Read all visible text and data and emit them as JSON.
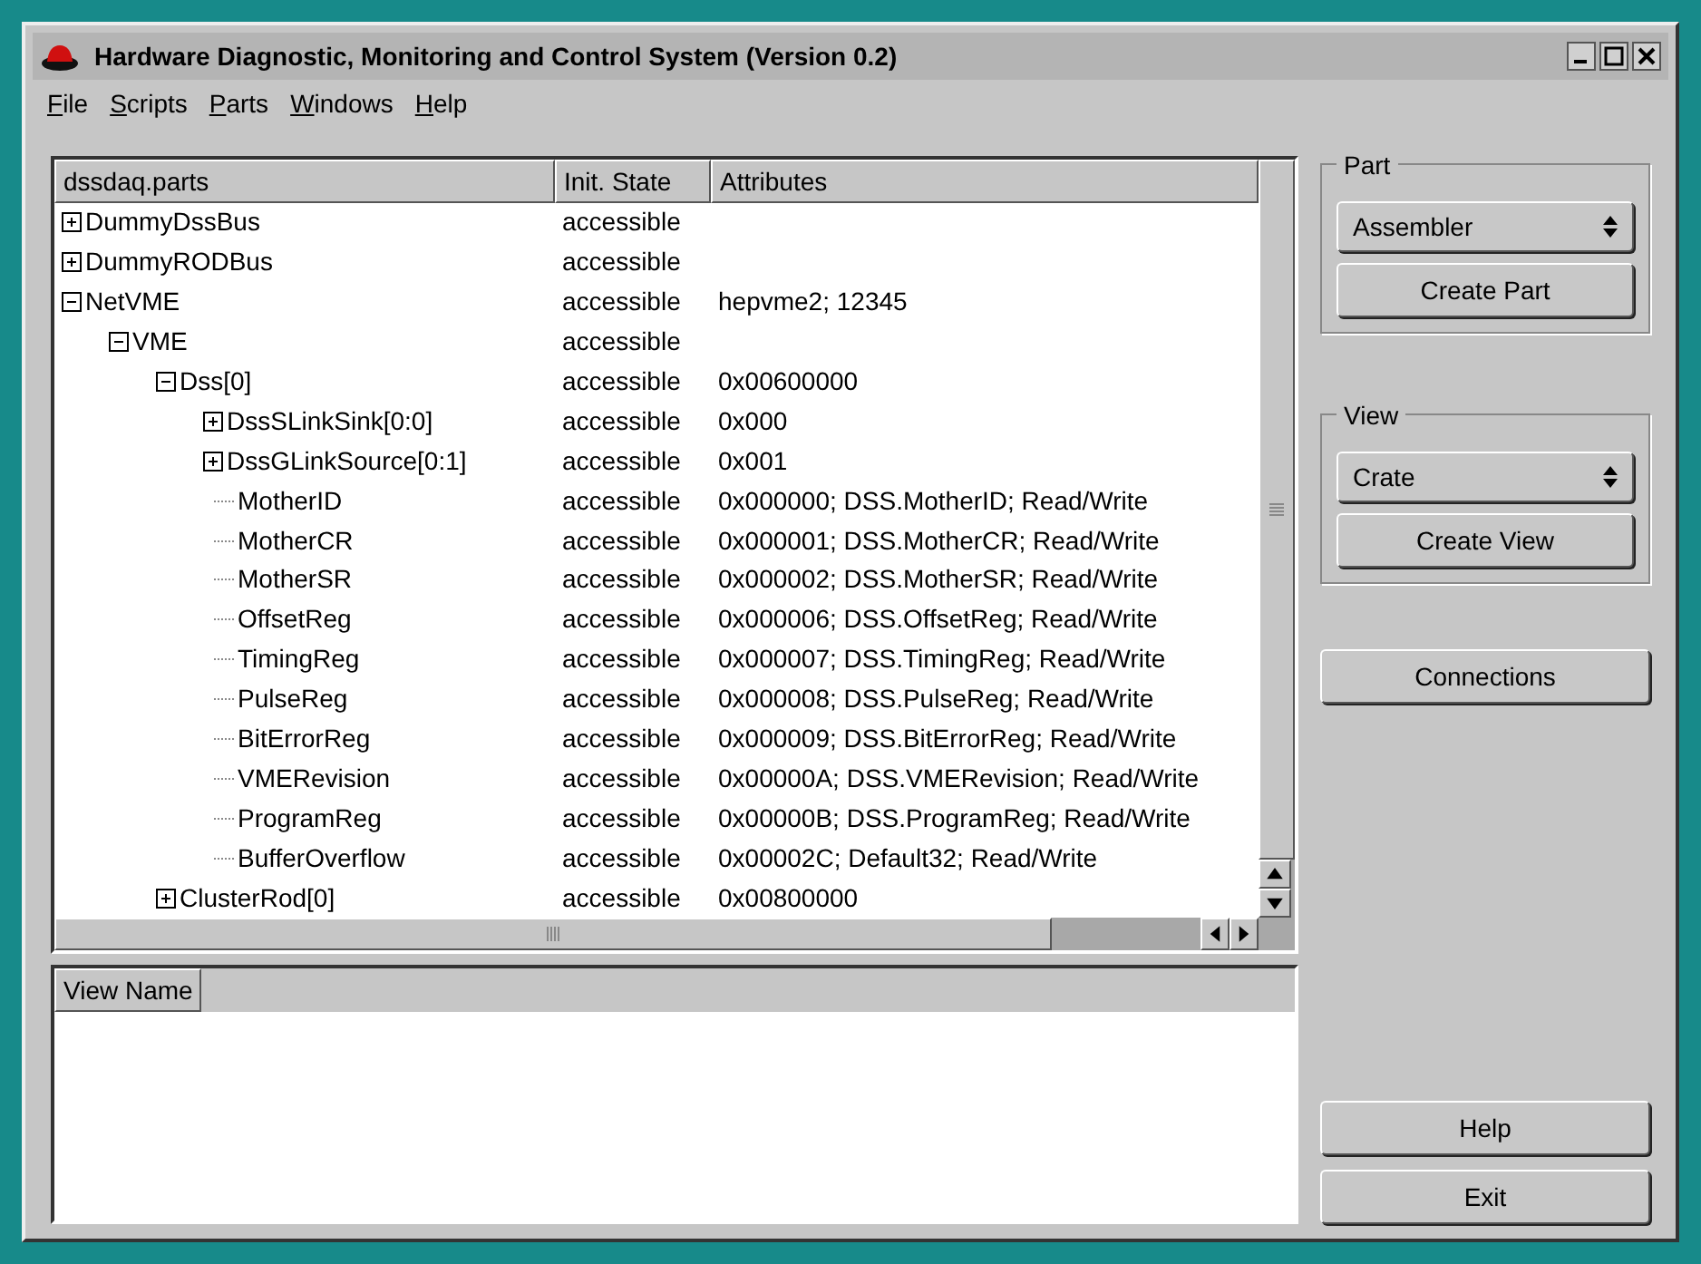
{
  "window": {
    "title": "Hardware Diagnostic, Monitoring and Control System (Version 0.2)"
  },
  "menu": [
    "File",
    "Scripts",
    "Parts",
    "Windows",
    "Help"
  ],
  "tree": {
    "columns": [
      "dssdaq.parts",
      "Init. State",
      "Attributes"
    ],
    "rows": [
      {
        "name": "DummyDssBus",
        "state": "accessible",
        "expanded": false
      },
      {
        "name": "DummyRODBus",
        "state": "accessible",
        "expanded": false
      },
      {
        "name": "NetVME",
        "state": "accessible",
        "attributes": "hepvme2; 12345",
        "expanded": true,
        "children": [
          {
            "name": "VME",
            "state": "accessible",
            "expanded": true,
            "children": [
              {
                "name": "Dss[0]",
                "state": "accessible",
                "attributes": "0x00600000",
                "expanded": true,
                "children": [
                  {
                    "name": "DssSLinkSink[0:0]",
                    "state": "accessible",
                    "attributes": "0x000",
                    "expanded": false
                  },
                  {
                    "name": "DssGLinkSource[0:1]",
                    "state": "accessible",
                    "attributes": "0x001",
                    "expanded": false
                  },
                  {
                    "name": "MotherID",
                    "state": "accessible",
                    "attributes": "0x000000; DSS.MotherID; Read/Write"
                  },
                  {
                    "name": "MotherCR",
                    "state": "accessible",
                    "attributes": "0x000001; DSS.MotherCR; Read/Write"
                  },
                  {
                    "name": "MotherSR",
                    "state": "accessible",
                    "attributes": "0x000002; DSS.MotherSR; Read/Write"
                  },
                  {
                    "name": "OffsetReg",
                    "state": "accessible",
                    "attributes": "0x000006; DSS.OffsetReg; Read/Write"
                  },
                  {
                    "name": "TimingReg",
                    "state": "accessible",
                    "attributes": "0x000007; DSS.TimingReg; Read/Write"
                  },
                  {
                    "name": "PulseReg",
                    "state": "accessible",
                    "attributes": "0x000008; DSS.PulseReg; Read/Write"
                  },
                  {
                    "name": "BitErrorReg",
                    "state": "accessible",
                    "attributes": "0x000009; DSS.BitErrorReg; Read/Write"
                  },
                  {
                    "name": "VMERevision",
                    "state": "accessible",
                    "attributes": "0x00000A; DSS.VMERevision; Read/Write"
                  },
                  {
                    "name": "ProgramReg",
                    "state": "accessible",
                    "attributes": "0x00000B; DSS.ProgramReg; Read/Write"
                  },
                  {
                    "name": "BufferOverflow",
                    "state": "accessible",
                    "attributes": "0x00002C; Default32; Read/Write"
                  }
                ]
              },
              {
                "name": "ClusterRod[0]",
                "state": "accessible",
                "attributes": "0x00800000",
                "expanded": false
              }
            ]
          }
        ]
      }
    ]
  },
  "views": {
    "columns": [
      "View Name"
    ]
  },
  "part": {
    "legend": "Part",
    "select": "Assembler",
    "button": "Create Part"
  },
  "view": {
    "legend": "View",
    "select": "Crate",
    "button": "Create View"
  },
  "buttons": [
    "Connections",
    "Help",
    "Exit"
  ]
}
